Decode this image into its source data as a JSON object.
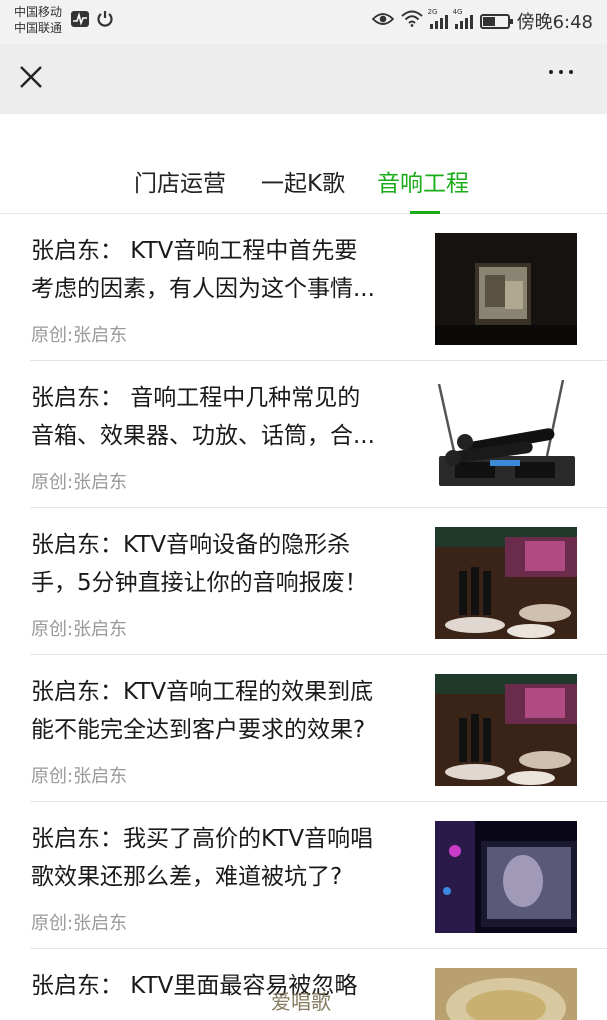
{
  "status_bar": {
    "carrier_1": "中国移动",
    "carrier_2": "中国联通",
    "time": "傍晚6:48",
    "icons": [
      "activity-icon",
      "power-icon",
      "eye-icon",
      "wifi-icon",
      "signal-2g-icon",
      "signal-4g-icon",
      "battery-icon"
    ],
    "sig_1_tag": "2G",
    "sig_2_tag": "4G"
  },
  "nav": {
    "close_icon": "close-icon",
    "more_icon": "more-icon"
  },
  "tabs": [
    {
      "label": "门店运营",
      "active": false
    },
    {
      "label": "一起K歌",
      "active": false
    },
    {
      "label": "音响工程",
      "active": true
    }
  ],
  "accent_color": "#1aad19",
  "articles": [
    {
      "title_line1": "张启东： KTV音响工程中首先要",
      "title_line2": "考虑的因素，有人因为这个事情...",
      "source": "原创:张启东"
    },
    {
      "title_line1": "张启东： 音响工程中几种常见的",
      "title_line2": "音箱、效果器、功放、话筒，合...",
      "source": "原创:张启东"
    },
    {
      "title_line1": "张启东：KTV音响设备的隐形杀",
      "title_line2": "手，5分钟直接让你的音响报废！",
      "source": "原创:张启东"
    },
    {
      "title_line1": "张启东：KTV音响工程的效果到底",
      "title_line2": "能不能完全达到客户要求的效果?",
      "source": "原创:张启东"
    },
    {
      "title_line1": "张启东：我买了高价的KTV音响唱",
      "title_line2": "歌效果还那么差，难道被坑了?",
      "source": "原创:张启东"
    },
    {
      "title_line1": "张启东： KTV里面最容易被忽略",
      "title_line2": "",
      "source": ""
    }
  ],
  "watermark": "爱唱歌"
}
